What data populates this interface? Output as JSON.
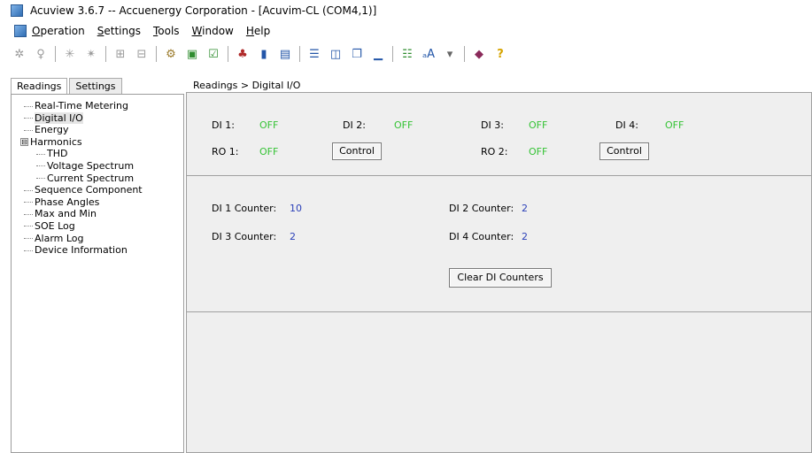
{
  "window": {
    "title": "Acuview 3.6.7 -- Accuenergy Corporation - [Acuvim-CL (COM4,1)]"
  },
  "menu": [
    "Operation",
    "Settings",
    "Tools",
    "Window",
    "Help"
  ],
  "toolbar_icons": [
    "gear-disabled-icon",
    "bulb-disabled-icon",
    "sep",
    "star-disabled-icon",
    "star2-disabled-icon",
    "sep",
    "grid-disabled-icon",
    "grid2-disabled-icon",
    "sep",
    "settings-gear-icon",
    "monitor-icon",
    "checklist-icon",
    "sep",
    "network-icon",
    "device-icon",
    "panel-icon",
    "sep",
    "tile-horizontal-icon",
    "tile-vertical-icon",
    "cascade-icon",
    "minimize-icon",
    "sep",
    "tree-icon",
    "font-icon",
    "dropdown-icon",
    "sep",
    "book-icon",
    "help-icon"
  ],
  "tabs": {
    "readings": "Readings",
    "settings": "Settings"
  },
  "tree": [
    {
      "label": "Real-Time Metering",
      "level": 1
    },
    {
      "label": "Digital I/O",
      "level": 1,
      "selected": true
    },
    {
      "label": "Energy",
      "level": 1
    },
    {
      "label": "Harmonics",
      "level": 1,
      "expander": "⊟"
    },
    {
      "label": "THD",
      "level": 2
    },
    {
      "label": "Voltage Spectrum",
      "level": 2
    },
    {
      "label": "Current Spectrum",
      "level": 2
    },
    {
      "label": "Sequence Component",
      "level": 1
    },
    {
      "label": "Phase Angles",
      "level": 1
    },
    {
      "label": "Max and Min",
      "level": 1
    },
    {
      "label": "SOE Log",
      "level": 1
    },
    {
      "label": "Alarm Log",
      "level": 1
    },
    {
      "label": "Device Information",
      "level": 1
    }
  ],
  "breadcrumb": "Readings > Digital I/O",
  "digital_io": {
    "di1_label": "DI 1:",
    "di1_value": "OFF",
    "di2_label": "DI 2:",
    "di2_value": "OFF",
    "di3_label": "DI 3:",
    "di3_value": "OFF",
    "di4_label": "DI 4:",
    "di4_value": "OFF",
    "ro1_label": "RO 1:",
    "ro1_value": "OFF",
    "ro2_label": "RO 2:",
    "ro2_value": "OFF",
    "control_label": "Control"
  },
  "counters": {
    "di1_label": "DI 1 Counter:",
    "di1_value": "10",
    "di2_label": "DI 2 Counter:",
    "di2_value": "2",
    "di3_label": "DI 3 Counter:",
    "di3_value": "2",
    "di4_label": "DI 4 Counter:",
    "di4_value": "2",
    "clear_label": "Clear DI Counters"
  },
  "colors": {
    "off": "#35c335",
    "counter": "#2a3fb8",
    "panel_bg": "#efefef"
  }
}
